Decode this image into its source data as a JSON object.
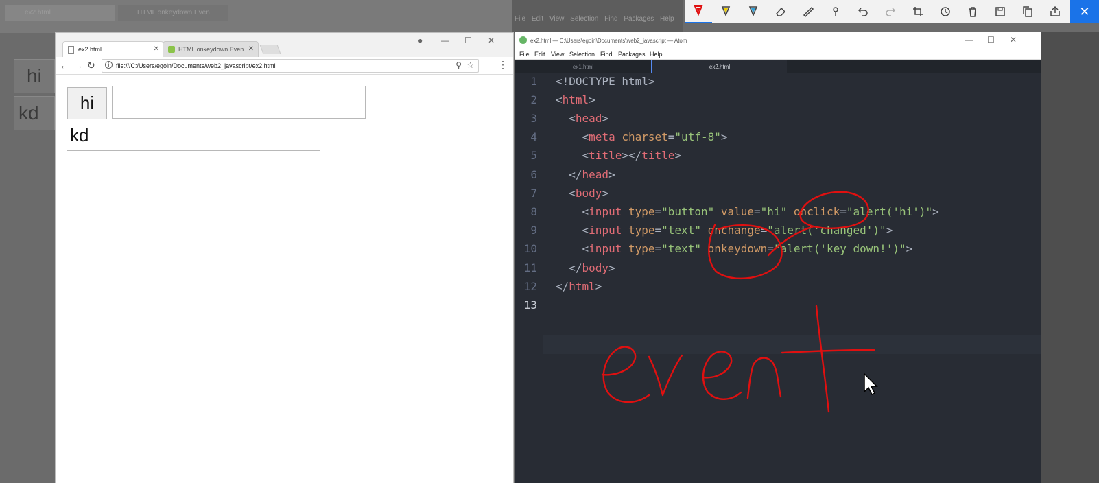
{
  "background": {
    "tab1": "ex2.html",
    "tab2": "HTML onkeydown Even",
    "hi": "hi",
    "kd": "kd",
    "atom_menu": "File Edit View Selection Find Packages Help"
  },
  "ink_toolbar": {
    "tools": [
      "ballpoint-pen-red",
      "pencil-yellow",
      "highlighter-blue",
      "eraser",
      "ruler",
      "touch-writing",
      "undo",
      "redo",
      "crop",
      "history",
      "delete",
      "save",
      "copy",
      "share",
      "close"
    ]
  },
  "chrome": {
    "tabs": [
      {
        "title": "ex2.html",
        "active": true
      },
      {
        "title": "HTML onkeydown Even",
        "active": false
      }
    ],
    "url": "file:///C:/Users/egoin/Documents/web2_javascript/ex2.html",
    "page": {
      "button_value": "hi",
      "text1_value": "",
      "text2_value": "kd"
    }
  },
  "atom": {
    "window_title": "ex2.html — C:\\Users\\egoin\\Documents\\web2_javascript — Atom",
    "menu": [
      "File",
      "Edit",
      "View",
      "Selection",
      "Find",
      "Packages",
      "Help"
    ],
    "tabs": [
      {
        "title": "ex1.html",
        "active": false
      },
      {
        "title": "ex2.html",
        "active": true
      }
    ],
    "line_numbers": [
      "1",
      "2",
      "3",
      "4",
      "5",
      "6",
      "7",
      "8",
      "9",
      "10",
      "11",
      "12",
      "13"
    ]
  },
  "annotation": {
    "handwritten_word": "event",
    "ink_color": "#e01010"
  },
  "colors": {
    "editor_bg": "#282c34",
    "tag": "#e06c75",
    "attr": "#d19a66",
    "string": "#98c379",
    "accent": "#1a73e8"
  }
}
